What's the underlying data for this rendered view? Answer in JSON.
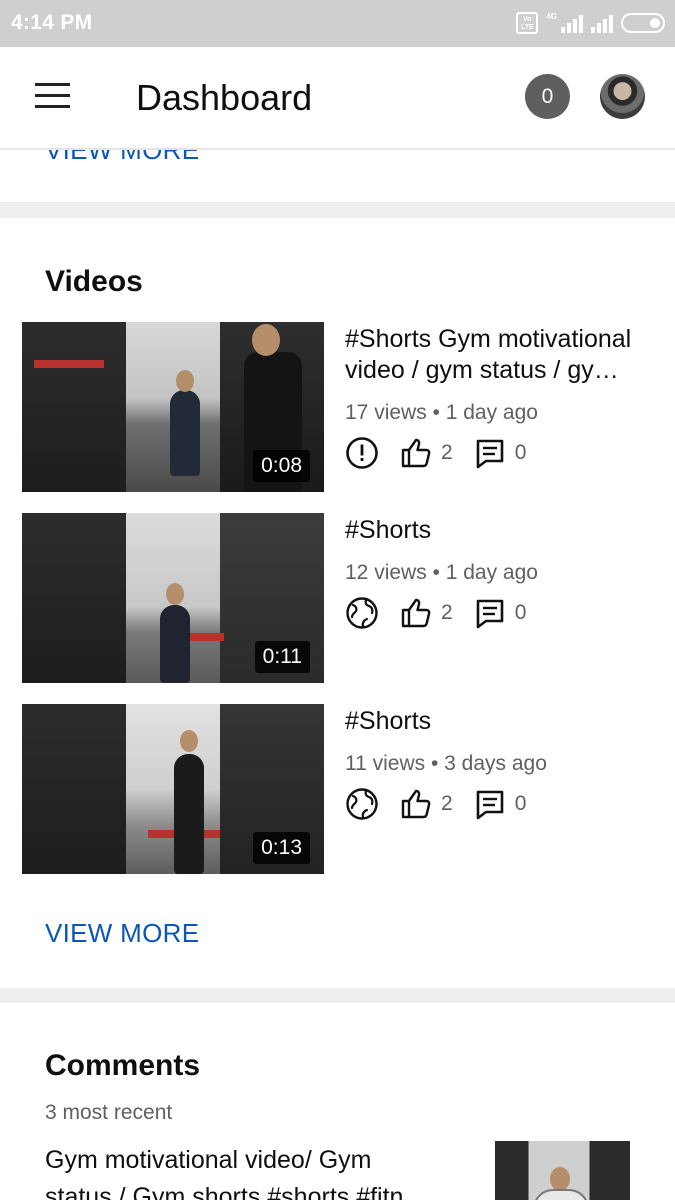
{
  "status_bar": {
    "time": "4:14 PM",
    "volte": "Vo LTE",
    "network": "4G"
  },
  "app_bar": {
    "title": "Dashboard",
    "notification_count": "0"
  },
  "previous_section": {
    "view_more_label": "VIEW MORE"
  },
  "videos": {
    "section_title": "Videos",
    "items": [
      {
        "title": "#Shorts Gym motivational video / gym status / gy…",
        "meta": "17 views • 1 day ago",
        "duration": "0:08",
        "visibility_icon": "alert-circle-icon",
        "likes": "2",
        "comments": "0"
      },
      {
        "title": "#Shorts",
        "meta": "12 views • 1 day ago",
        "duration": "0:11",
        "visibility_icon": "globe-icon",
        "likes": "2",
        "comments": "0"
      },
      {
        "title": "#Shorts",
        "meta": "11 views • 3 days ago",
        "duration": "0:13",
        "visibility_icon": "globe-icon",
        "likes": "2",
        "comments": "0"
      }
    ],
    "view_more_label": "VIEW MORE"
  },
  "comments": {
    "section_title": "Comments",
    "subtitle": "3 most recent",
    "first_comment_video_title": "Gym motivational video/ Gym status / Gym shorts #shorts #fitn"
  },
  "colors": {
    "status_bar_bg": "#cfcfcf",
    "link_blue": "#0b57b8",
    "badge_bg": "#5f5f5f",
    "section_divider": "#eeeeee"
  }
}
